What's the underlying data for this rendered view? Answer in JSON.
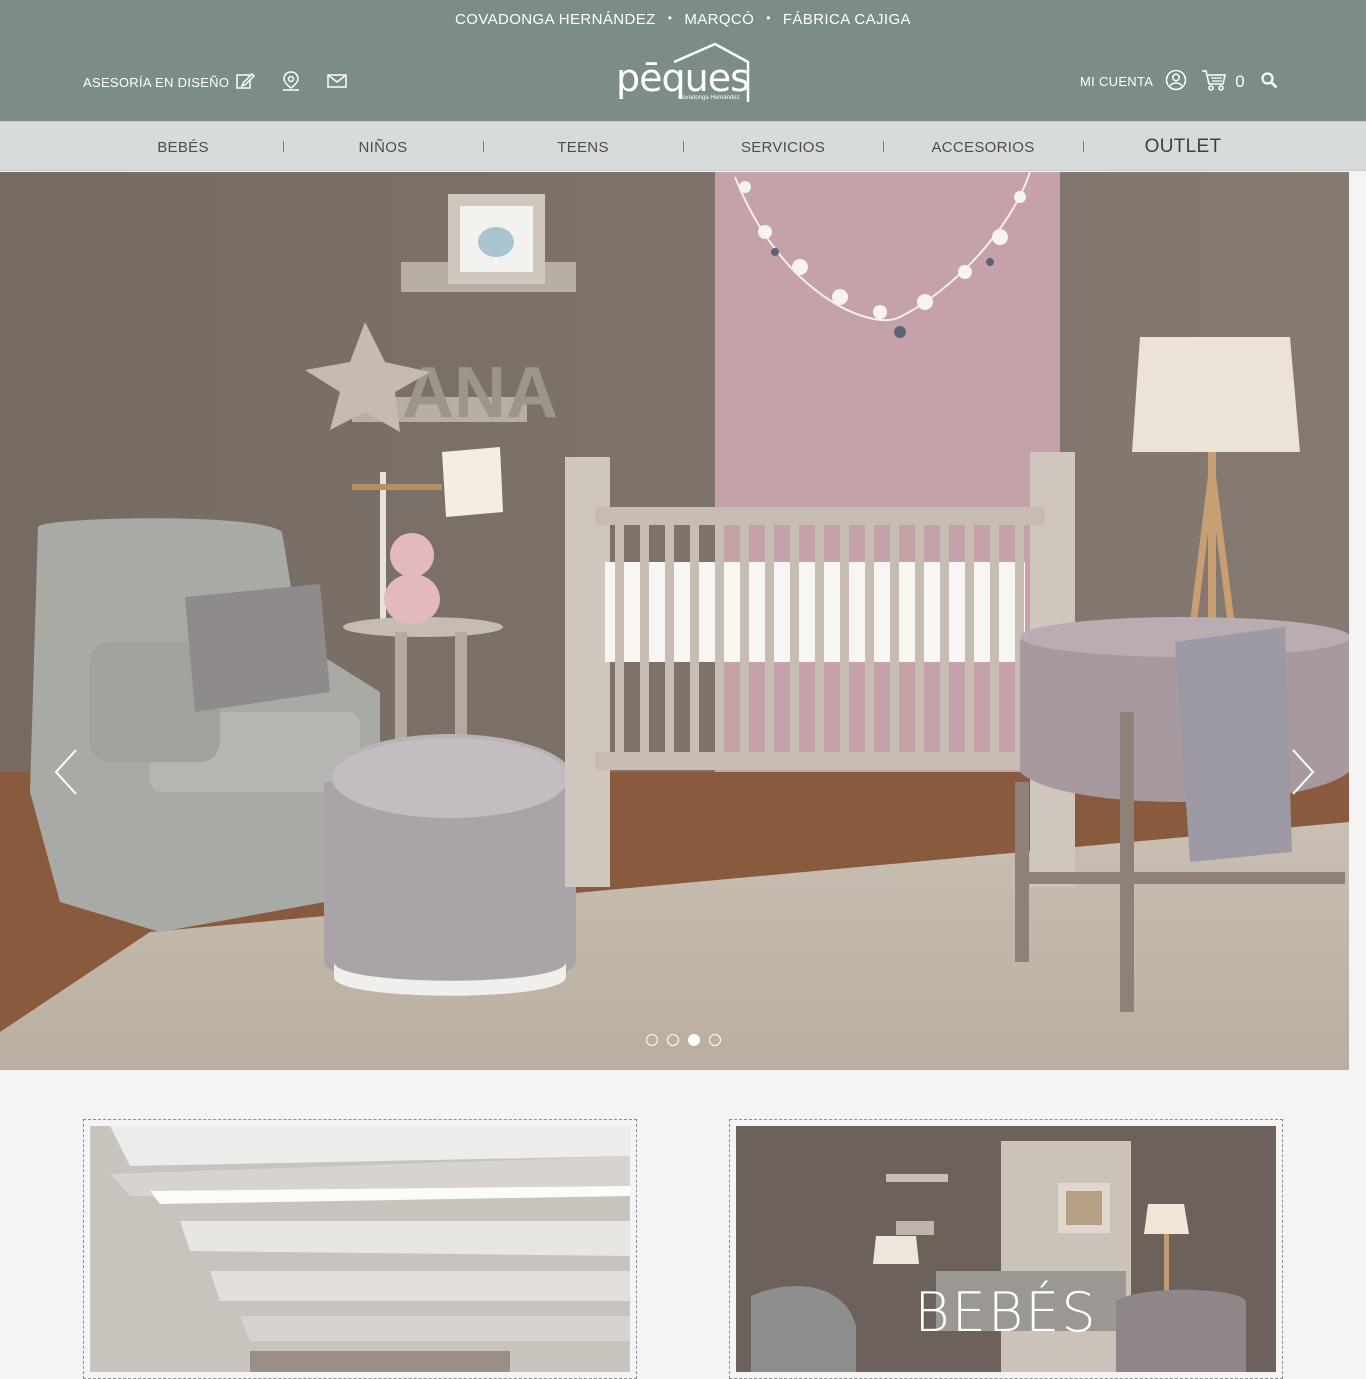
{
  "header": {
    "brands": [
      "COVADONGA HERNÁNDEZ",
      "MARQCÓ",
      "FÁBRICA CAJIGA"
    ],
    "brand_separator": "•",
    "design_link": "ASESORÍA EN DISEÑO",
    "logo_word": "pēques",
    "logo_sub": "Covadonga Hernández",
    "account_label": "MI CUENTA",
    "cart_count": "0",
    "icons": [
      "edit-icon",
      "location-pin-icon",
      "mail-icon",
      "user-circle-icon",
      "cart-icon",
      "search-icon"
    ]
  },
  "nav": {
    "items": [
      "BEBÉS",
      "NIÑOS",
      "TEENS",
      "SERVICIOS",
      "ACCESORIOS",
      "OUTLET"
    ]
  },
  "hero": {
    "slide_count": 4,
    "active_slide": 3,
    "decor_name": "ANA"
  },
  "cards": [
    {
      "label": ""
    },
    {
      "label": "BEBÉS"
    }
  ],
  "colors": {
    "header_bg": "#7c8c88",
    "nav_bg": "#d7dcdb",
    "page_bg": "#f3f4f3",
    "wall": "#7b7169",
    "accent_wall": "#c7a3ae"
  }
}
